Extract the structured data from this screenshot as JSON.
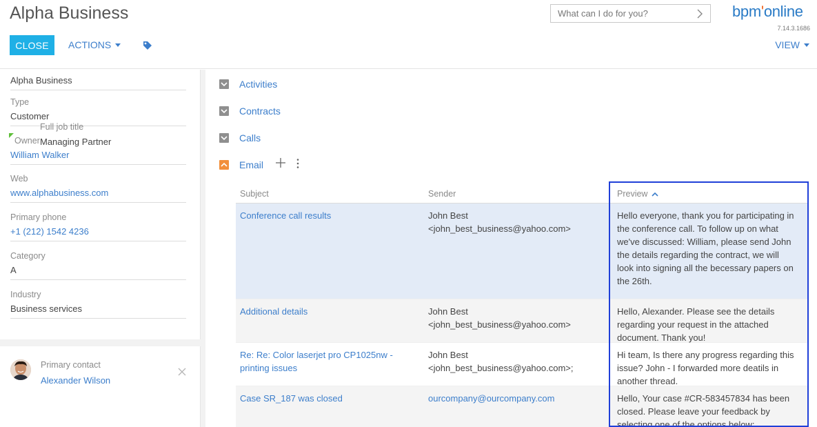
{
  "header": {
    "title": "Alpha Business",
    "close_label": "CLOSE",
    "actions_label": "ACTIONS",
    "search_placeholder": "What can I do for you?",
    "logo_text": "bpm",
    "logo_dot": "'",
    "logo_text2": "online",
    "version": "7.14.3.1686",
    "view_label": "VIEW"
  },
  "profile": {
    "account_name": "Alpha Business",
    "fields": [
      {
        "label": "Type",
        "value": "Customer"
      },
      {
        "label": "Owner",
        "value": "William Walker"
      },
      {
        "label": "Web",
        "value": "www.alphabusiness.com"
      },
      {
        "label": "Primary phone",
        "value": "+1 (212) 1542 4236"
      },
      {
        "label": "Category",
        "value": "A"
      },
      {
        "label": "Industry",
        "value": "Business services"
      }
    ]
  },
  "contact": {
    "label": "Primary contact",
    "name": "Alexander Wilson",
    "job_label": "Full job title",
    "job_value": "Managing Partner"
  },
  "sections": {
    "activities": "Activities",
    "contracts": "Contracts",
    "calls": "Calls",
    "email": "Email"
  },
  "email_grid": {
    "columns": {
      "subject": "Subject",
      "sender": "Sender",
      "preview": "Preview"
    },
    "rows": [
      {
        "subject": "Conference call results",
        "sender": "John Best <john_best_business@yahoo.com>",
        "preview": "Hello everyone, thank you for participating in the conference call. To follow up on what we've discussed: William, please send John the details regarding the contract, we will look into signing all the becessary papers on the 26th."
      },
      {
        "subject": "Additional details",
        "sender": "John Best <john_best_business@yahoo.com>",
        "preview": "Hello, Alexander. Please see the details regarding your request in the attached document. Thank you!"
      },
      {
        "subject": "Re: Re: Color laserjet pro CP1025nw - printing issues",
        "sender": "John Best <john_best_business@yahoo.com>;",
        "preview": "Hi team, Is there any progress regarding this issue? John - I forwarded more deatils in another thread."
      },
      {
        "subject": "Case SR_187 was closed",
        "sender": "ourcompany@ourcompany.com",
        "preview": "Hello, Your case #CR-583457834 has been closed. Please leave your feedback by selecting one of the options below:"
      }
    ]
  },
  "colors": {
    "accent": "#1fb0e6",
    "link": "#3c7ecb",
    "selected_row": "#e3ebf7",
    "highlight_border": "#1f3fd8",
    "section_open": "#f28f3b"
  }
}
